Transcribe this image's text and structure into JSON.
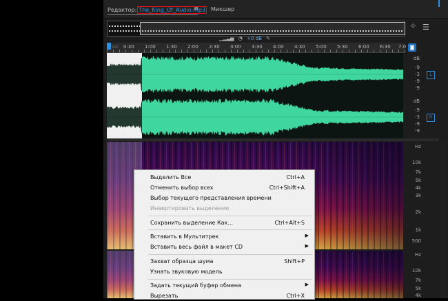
{
  "tabs": {
    "editor_label": "Редактор:",
    "file_name": "The_King_Of_Audio.mp3",
    "menu_icon": "≡",
    "mixer_label": "Микшер"
  },
  "overview": {
    "zoom_icon": "zoom-navigator-icon",
    "list_icon": "list-icon"
  },
  "controls": {
    "volume_value": "+0 dB",
    "hud_icon": "knob-icon"
  },
  "ruler": {
    "ticks": [
      "ч:с",
      "0:30",
      "1:00",
      "1:30",
      "2:00",
      "2:30",
      "3:00",
      "3:30",
      "4:00",
      "4:30",
      "5:00",
      "5:30",
      "6:00",
      "6:30",
      "7:0"
    ]
  },
  "channels": {
    "db_unit": "dB",
    "db_ticks": [
      "-9",
      "-3",
      "-9",
      "-9",
      "-3"
    ],
    "left_tag": "L",
    "right_tag": "R"
  },
  "spectrum": {
    "hz_unit": "Hz",
    "top_ticks": [
      "Hz",
      "10k",
      "7k",
      "5k",
      "4k",
      "3k",
      "2k",
      "1k",
      "500"
    ],
    "bottom_ticks": [
      "Hz",
      "10k",
      "7k",
      "5k",
      "4k"
    ]
  },
  "context_menu": {
    "items": [
      {
        "label": "Выделить Все",
        "shortcut": "Ctrl+A",
        "disabled": false,
        "submenu": false
      },
      {
        "label": "Отменить выбор всех",
        "shortcut": "Ctrl+Shift+A",
        "disabled": false,
        "submenu": false
      },
      {
        "label": "Выбор текущего представления времени",
        "shortcut": "",
        "disabled": false,
        "submenu": false
      },
      {
        "label": "Инвертировать выделение",
        "shortcut": "",
        "disabled": true,
        "submenu": false
      },
      {
        "label": "Сохранить выделение Как...",
        "shortcut": "Ctrl+Alt+S",
        "disabled": false,
        "submenu": false
      },
      {
        "label": "Вставить в Мультитрек",
        "shortcut": "",
        "disabled": false,
        "submenu": true
      },
      {
        "label": "Вставить весь файл в макет CD",
        "shortcut": "",
        "disabled": false,
        "submenu": true
      },
      {
        "label": "Захват образца шума",
        "shortcut": "Shift+P",
        "disabled": false,
        "submenu": false
      },
      {
        "label": "Узнать звуковую модель",
        "shortcut": "",
        "disabled": false,
        "submenu": false
      },
      {
        "label": "Задать текущий буфер обмена",
        "shortcut": "",
        "disabled": false,
        "submenu": true
      },
      {
        "label": "Вырезать",
        "shortcut": "Ctrl+X",
        "disabled": false,
        "submenu": false
      }
    ]
  },
  "colors": {
    "waveform": "#3fd6a0",
    "accent": "#2f8fe0",
    "file_highlight": "#e0101a"
  }
}
